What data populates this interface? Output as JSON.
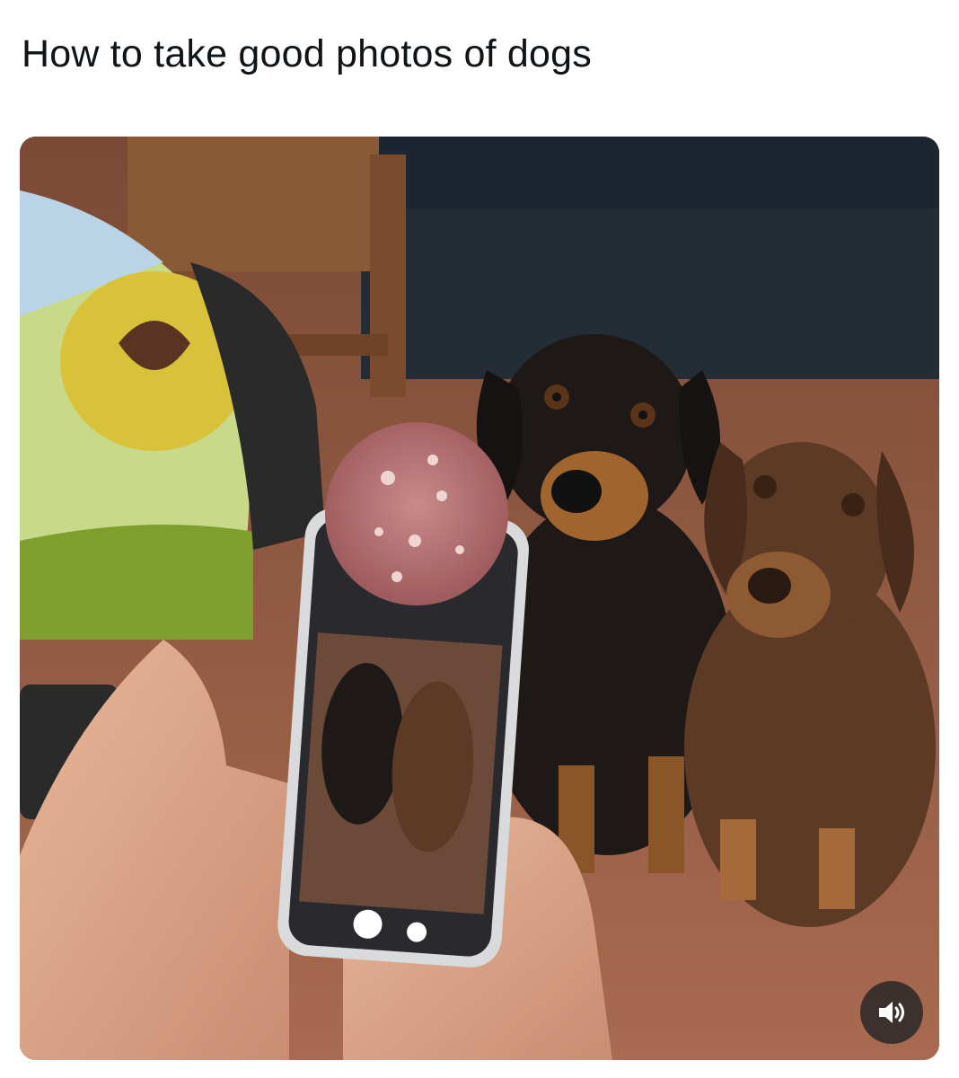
{
  "post": {
    "title": "How to take good photos of dogs"
  },
  "media": {
    "type": "video",
    "icons": {
      "sound": "speaker-volume-icon"
    }
  }
}
